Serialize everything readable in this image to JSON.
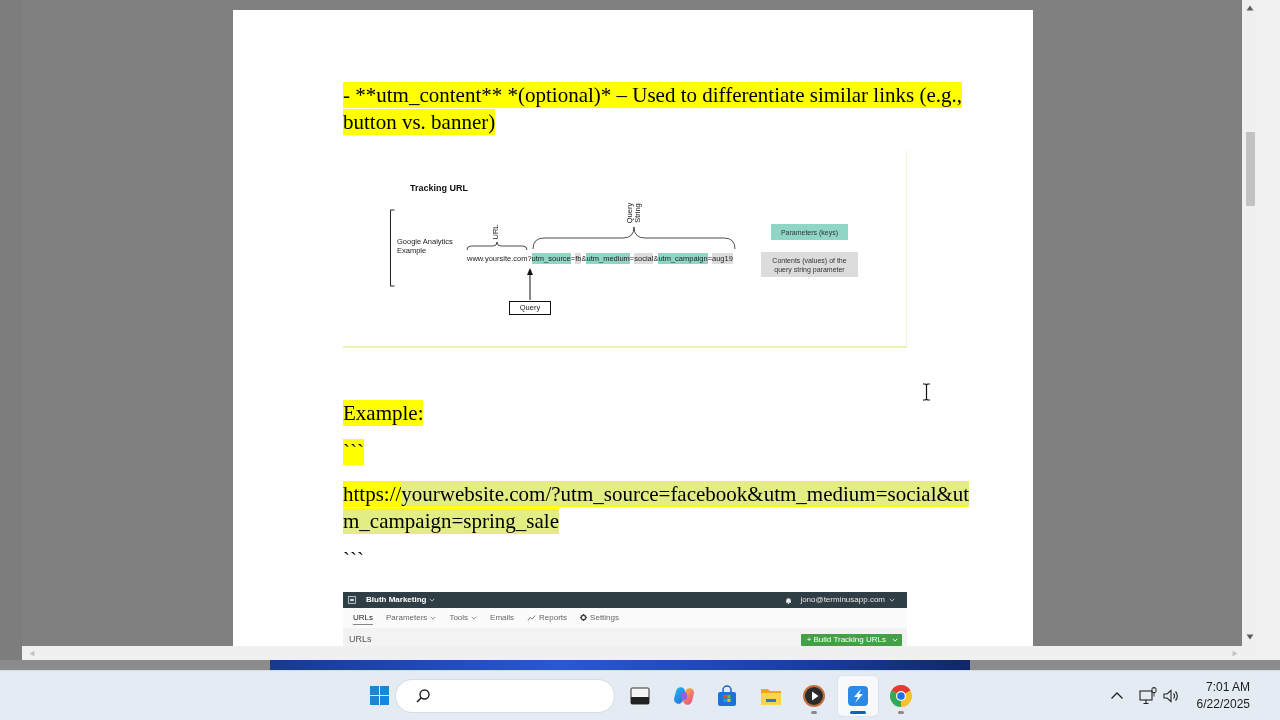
{
  "document": {
    "blocks": [
      {
        "kind": "paragraph",
        "highlighted": true,
        "text": "- **utm_content** *(optional)* – Used to differentiate similar links (e.g., button vs. banner)"
      },
      {
        "kind": "diagram",
        "title": "Tracking URL",
        "side_label": "Google Analytics Example",
        "url_label": "URL",
        "query_string_label": "Query String",
        "url_parts": [
          {
            "kind": "plain",
            "text": "www.yoursite.com?"
          },
          {
            "kind": "key",
            "text": "utm_source"
          },
          {
            "kind": "plain",
            "text": "="
          },
          {
            "kind": "value",
            "text": "fb"
          },
          {
            "kind": "plain",
            "text": "&"
          },
          {
            "kind": "key",
            "text": "utm_medium"
          },
          {
            "kind": "plain",
            "text": "="
          },
          {
            "kind": "value",
            "text": "social"
          },
          {
            "kind": "plain",
            "text": "&"
          },
          {
            "kind": "key",
            "text": "utm_campaign"
          },
          {
            "kind": "plain",
            "text": "="
          },
          {
            "kind": "value",
            "text": "aug19"
          }
        ],
        "query_label": "Query",
        "legend": [
          {
            "text": "Parameters (keys)",
            "color": "#8fd6c6"
          },
          {
            "text": "Contents (values) of the query string parameter",
            "color": "#dcdcdc"
          }
        ]
      },
      {
        "kind": "paragraph",
        "highlighted": true,
        "text": "Example:"
      },
      {
        "kind": "paragraph",
        "highlighted": true,
        "text": "```"
      },
      {
        "kind": "url",
        "highlighted": true,
        "segments": [
          {
            "text": "https://",
            "selected": false
          },
          {
            "text": "yourwebsite.com/?utm_source=facebook&utm_medium=social&utm_campaign=spring_sale",
            "selected": true
          }
        ]
      },
      {
        "kind": "paragraph",
        "highlighted": false,
        "text": "```"
      },
      {
        "kind": "app_screenshot",
        "workspace": "Bluth Marketing",
        "account": "jono@terminusapp.com",
        "nav": [
          {
            "kind": "tab",
            "label": "URLs",
            "selected": true
          },
          {
            "kind": "dropdown",
            "label": "Parameters",
            "selected": false
          },
          {
            "kind": "dropdown",
            "label": "Tools",
            "selected": false
          },
          {
            "kind": "tab",
            "label": "Emails",
            "selected": false
          },
          {
            "kind": "chart",
            "label": "Reports",
            "selected": false
          },
          {
            "kind": "gear",
            "label": "Settings",
            "selected": false
          }
        ],
        "heading": "URLs",
        "action_button": "+ Build Tracking URLs"
      }
    ]
  },
  "taskbar": {
    "apps": [
      {
        "kind": "window",
        "running": false,
        "active": false
      },
      {
        "kind": "swirl",
        "running": false,
        "active": false
      },
      {
        "kind": "bag",
        "running": false,
        "active": false
      },
      {
        "kind": "folder",
        "running": false,
        "active": false
      },
      {
        "kind": "play",
        "running": true,
        "active": false
      },
      {
        "kind": "lightning",
        "running": true,
        "active": true
      },
      {
        "kind": "browser",
        "running": true,
        "active": false
      }
    ],
    "time": "7:01 AM",
    "date": "6/22/2025"
  }
}
